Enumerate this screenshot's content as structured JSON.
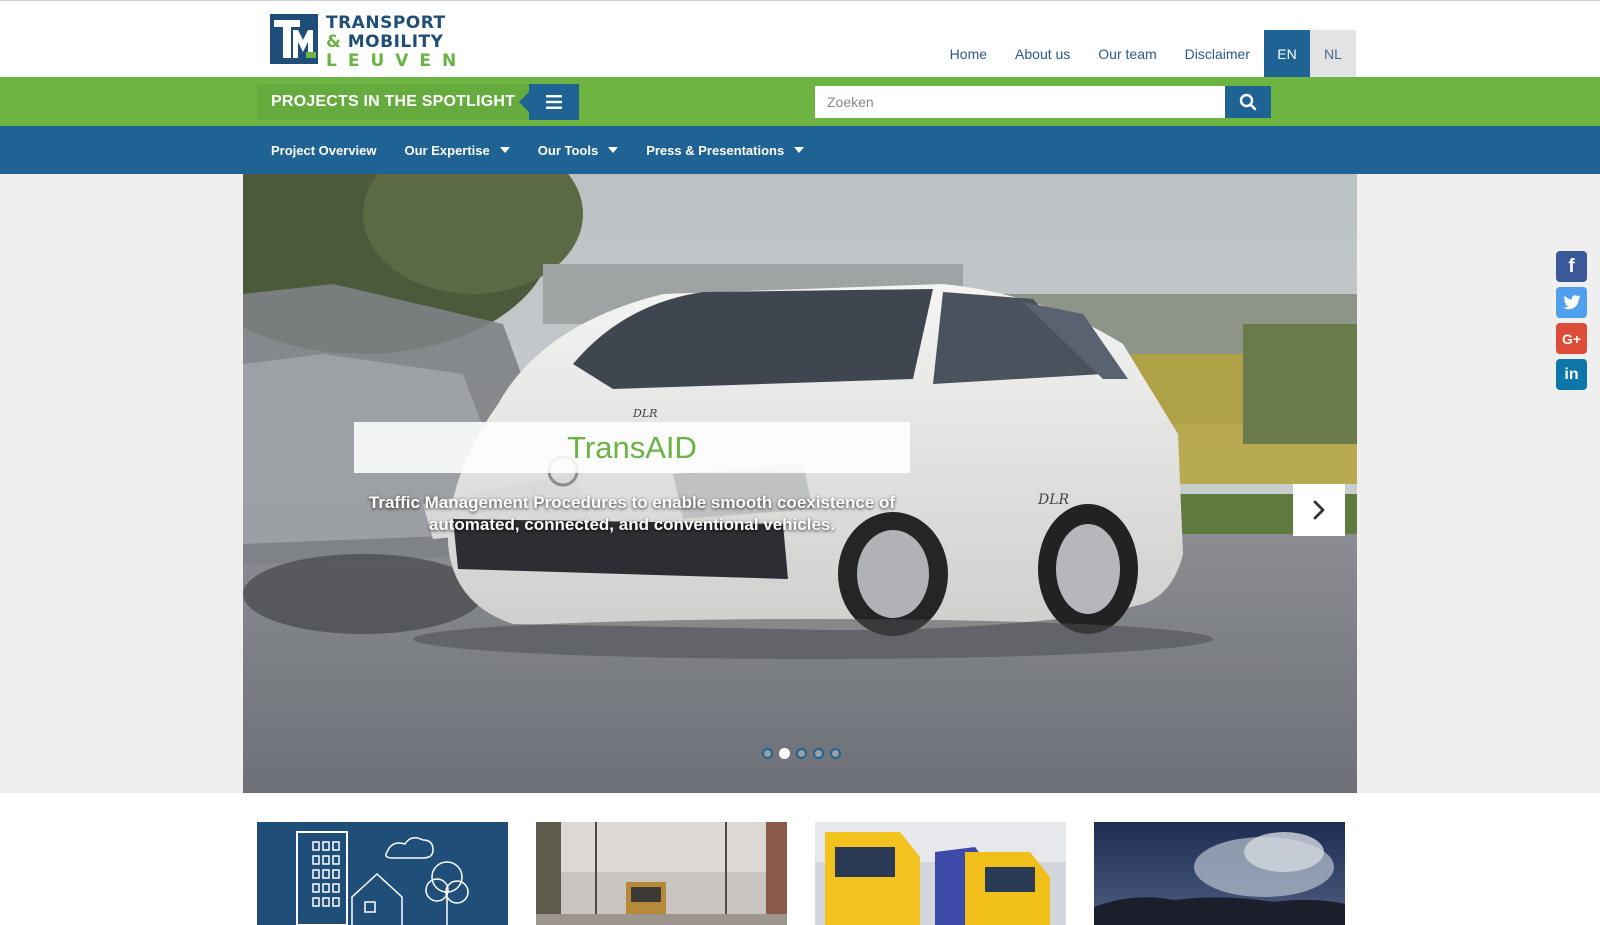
{
  "logo": {
    "line1": "TRANSPORT",
    "line2_amp": "&",
    "line2": " MOBILITY",
    "line3": "LEUVEN"
  },
  "topnav": {
    "items": [
      "Home",
      "About us",
      "Our team",
      "Disclaimer"
    ],
    "lang_en": "EN",
    "lang_nl": "NL"
  },
  "greenbar": {
    "spotlight_label": "PROJECTS IN THE SPOTLIGHT",
    "search_placeholder": "Zoeken"
  },
  "mainnav": {
    "items": [
      {
        "label": "Project Overview",
        "dropdown": false
      },
      {
        "label": "Our Expertise",
        "dropdown": true
      },
      {
        "label": "Our Tools",
        "dropdown": true
      },
      {
        "label": "Press & Presentations",
        "dropdown": true
      }
    ]
  },
  "hero": {
    "title": "TransAID",
    "subtitle": "Traffic Management Procedures to enable smooth coexistence of automated, connected, and conventional vehicles.",
    "slide_count": 5,
    "active_slide": 2
  },
  "social": [
    "facebook-icon",
    "twitter-icon",
    "google-plus-icon",
    "linkedin-icon"
  ],
  "colors": {
    "green": "#6db443",
    "blue": "#1f6394",
    "logo_blue": "#1f4e79",
    "logo_green": "#6ab344"
  }
}
